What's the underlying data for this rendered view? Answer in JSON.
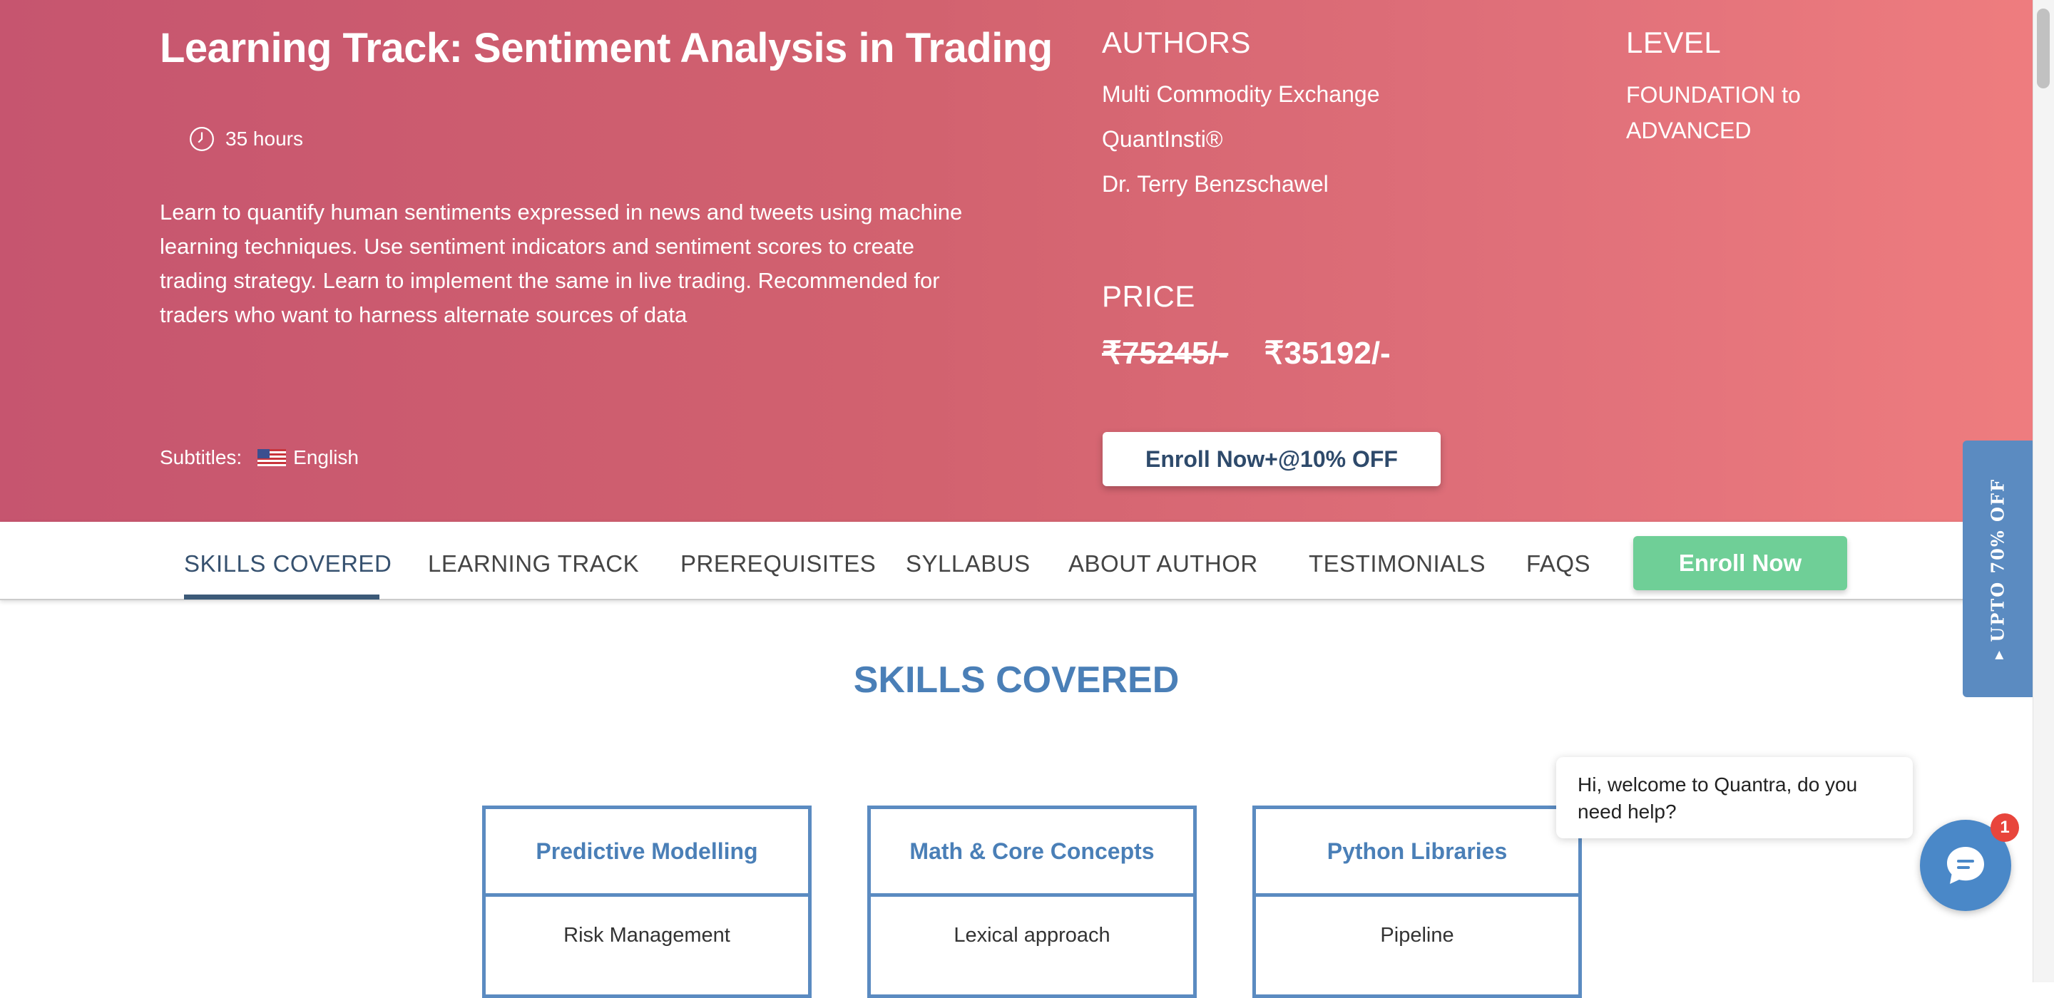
{
  "hero": {
    "title": "Learning Track: Sentiment Analysis in Trading",
    "duration": "35 hours",
    "description": "Learn to quantify human sentiments expressed in news and tweets using machine learning techniques. Use sentiment indicators and sentiment scores to create trading strategy. Learn to implement the same in live trading. Recommended for traders who want to harness alternate sources of data",
    "subtitles_label": "Subtitles:",
    "subtitles_language": "English",
    "authors_heading": "AUTHORS",
    "authors": [
      "Multi Commodity Exchange",
      "QuantInsti®",
      "Dr. Terry Benzschawel"
    ],
    "level_heading": "LEVEL",
    "level_value": "FOUNDATION to ADVANCED",
    "price_heading": "PRICE",
    "price_original": "₹75245/-",
    "price_discounted": "₹35192/-",
    "enroll_button": "Enroll Now+@10% OFF"
  },
  "nav": {
    "items": [
      "SKILLS COVERED",
      "LEARNING TRACK",
      "PREREQUISITES",
      "SYLLABUS",
      "ABOUT AUTHOR",
      "TESTIMONIALS",
      "FAQS"
    ],
    "active": "SKILLS COVERED",
    "enroll_button": "Enroll Now"
  },
  "side_tab": {
    "label": "▸ UPTO 70% OFF"
  },
  "skills": {
    "title": "SKILLS COVERED",
    "cards": [
      {
        "title": "Predictive Modelling",
        "item": "Risk Management"
      },
      {
        "title": "Math & Core Concepts",
        "item": "Lexical approach"
      },
      {
        "title": "Python Libraries",
        "item": "Pipeline"
      }
    ]
  },
  "chat": {
    "message": "Hi, welcome to Quantra, do you need help?",
    "badge_count": "1"
  },
  "colors": {
    "hero_gradient_start": "#c6556f",
    "hero_gradient_end": "#ef7d7f",
    "accent_blue": "#4a7fb7",
    "enroll_green": "#6fcf97",
    "badge_red": "#e8453c"
  }
}
